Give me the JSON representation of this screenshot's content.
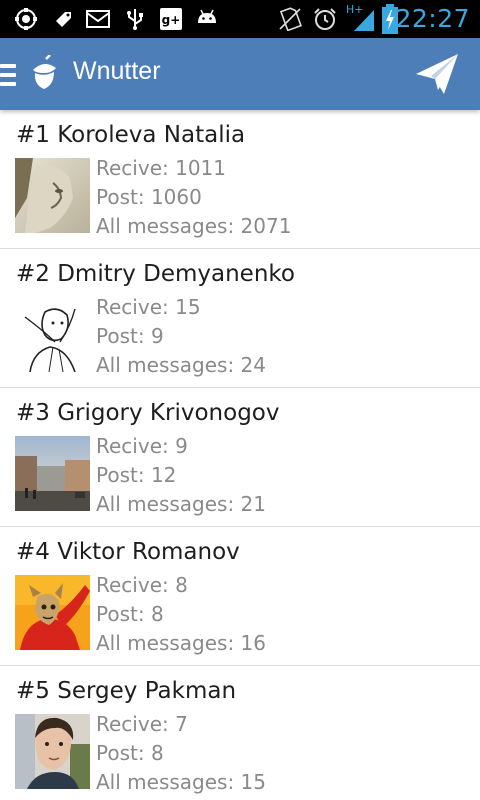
{
  "status_bar": {
    "time": "22:27",
    "network": "H+",
    "icons": [
      "settings-icon",
      "tag-icon",
      "mail-icon",
      "usb-icon",
      "google-plus-icon",
      "android-icon",
      "no-sim-icon",
      "alarm-icon",
      "signal-icon",
      "battery-charging-icon"
    ]
  },
  "action_bar": {
    "title": "Wnutter",
    "menu_icon": "hamburger-icon",
    "logo_icon": "acorn-icon",
    "send_icon": "paper-plane-icon",
    "color": "#4e7eb8"
  },
  "users": [
    {
      "rank_name": "#1 Koroleva Natalia",
      "recive": "Recive: 1011",
      "post": "Post: 1060",
      "all": "All messages: 2071"
    },
    {
      "rank_name": "#2 Dmitry Demyanenko",
      "recive": "Recive: 15",
      "post": "Post: 9",
      "all": "All messages: 24"
    },
    {
      "rank_name": "#3 Grigory Krivonogov",
      "recive": "Recive: 9",
      "post": "Post: 12",
      "all": "All messages: 21"
    },
    {
      "rank_name": "#4 Viktor Romanov",
      "recive": "Recive: 8",
      "post": "Post: 8",
      "all": "All messages: 16"
    },
    {
      "rank_name": "#5 Sergey Pakman",
      "recive": "Recive: 7",
      "post": "Post: 8",
      "all": "All messages: 15"
    }
  ]
}
